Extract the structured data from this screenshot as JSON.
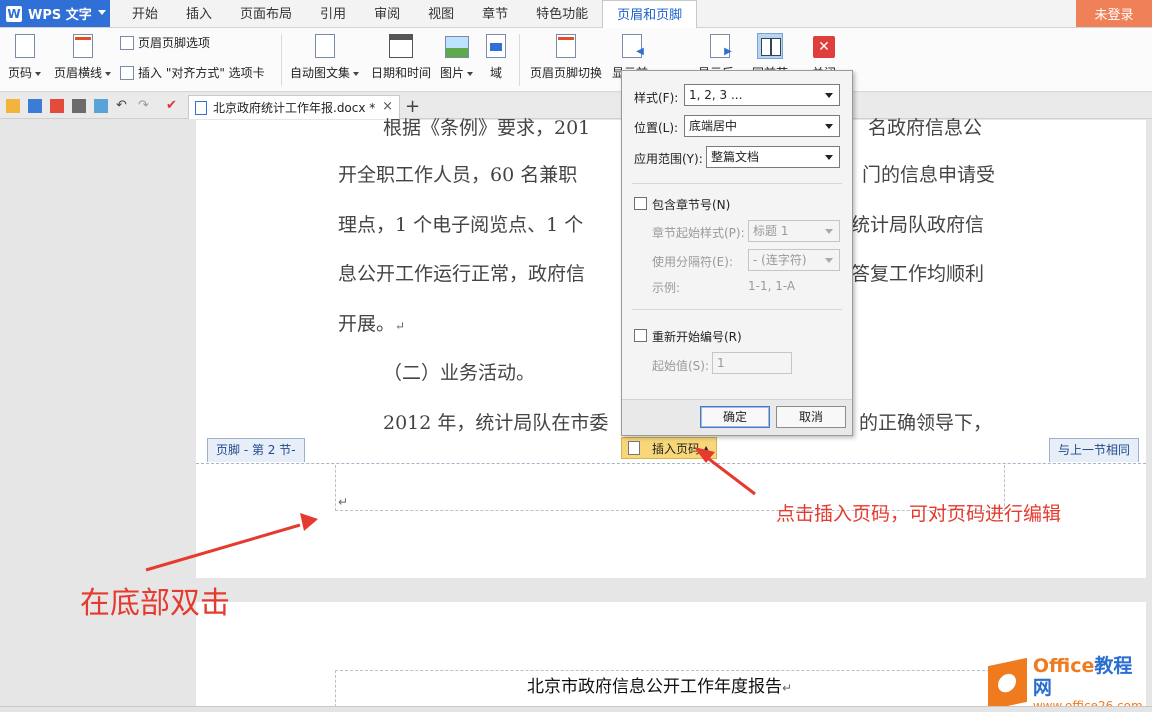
{
  "app": {
    "name": "WPS 文字",
    "logo_letter": "W",
    "login": "未登录"
  },
  "tabs": [
    "开始",
    "插入",
    "页面布局",
    "引用",
    "审阅",
    "视图",
    "章节",
    "特色功能",
    "页眉和页脚"
  ],
  "active_tab_index": 8,
  "ribbon": {
    "page_num": "页码",
    "header_line": "页眉横线",
    "header_footer_options": "页眉页脚选项",
    "insert_align_tab": "插入 \"对齐方式\" 选项卡",
    "auto_text": "自动图文集",
    "date_time": "日期和时间",
    "picture": "图片",
    "field": "域",
    "switch_hf": "页眉页脚切换",
    "show_prev": "显示前一项",
    "show_next": "显示后一项",
    "same_as_prev": "同前节",
    "close": "关闭"
  },
  "document_tab": {
    "name": "北京政府统计工作年报.docx *",
    "close": "×",
    "new_tab": "+"
  },
  "body": {
    "line1": "根据《条例》要求，201",
    "line1b": "名政府信息公",
    "line2a": "开全职工作人员，60 名兼职",
    "line2b": "门的信息申请受",
    "line3a": "理点，1 个电子阅览点、1 个",
    "line3b": "统计局队政府信",
    "line4a": "息公开工作运行正常，政府信",
    "line4b": "答复工作均顺利",
    "line5": "开展。",
    "heading": "（二）业务活动。",
    "line6a": "2012 年，统计局队在市委",
    "line6b": "的正确领导下，",
    "para_mark": "↵"
  },
  "footer": {
    "label": "页脚 - 第 2 节-",
    "same_as_prev": "与上一节相同",
    "insert_page_num": "插入页码"
  },
  "popup": {
    "style_label": "样式(F):",
    "style_value": "1, 2, 3 ...",
    "position_label": "位置(L):",
    "position_value": "底端居中",
    "scope_label": "应用范围(Y):",
    "scope_value": "整篇文档",
    "include_chapter": "包含章节号(N)",
    "chapter_style_label": "章节起始样式(P):",
    "chapter_style_value": "标题 1",
    "separator_label": "使用分隔符(E):",
    "separator_value": "-   (连字符)",
    "example_label": "示例:",
    "example_value": "1-1, 1-A",
    "restart": "重新开始编号(R)",
    "start_label": "起始值(S):",
    "start_value": "1",
    "ok": "确定",
    "cancel": "取消"
  },
  "page2": {
    "header_title": "北京市政府信息公开工作年度报告"
  },
  "annotations": {
    "click_note": "点击插入页码，可对页码进行编辑",
    "double_click_note": "在底部双击",
    "color": "#e53a2e"
  },
  "watermark": {
    "brand": "Office",
    "brand2": "教程网",
    "url": "www.office26.com"
  }
}
